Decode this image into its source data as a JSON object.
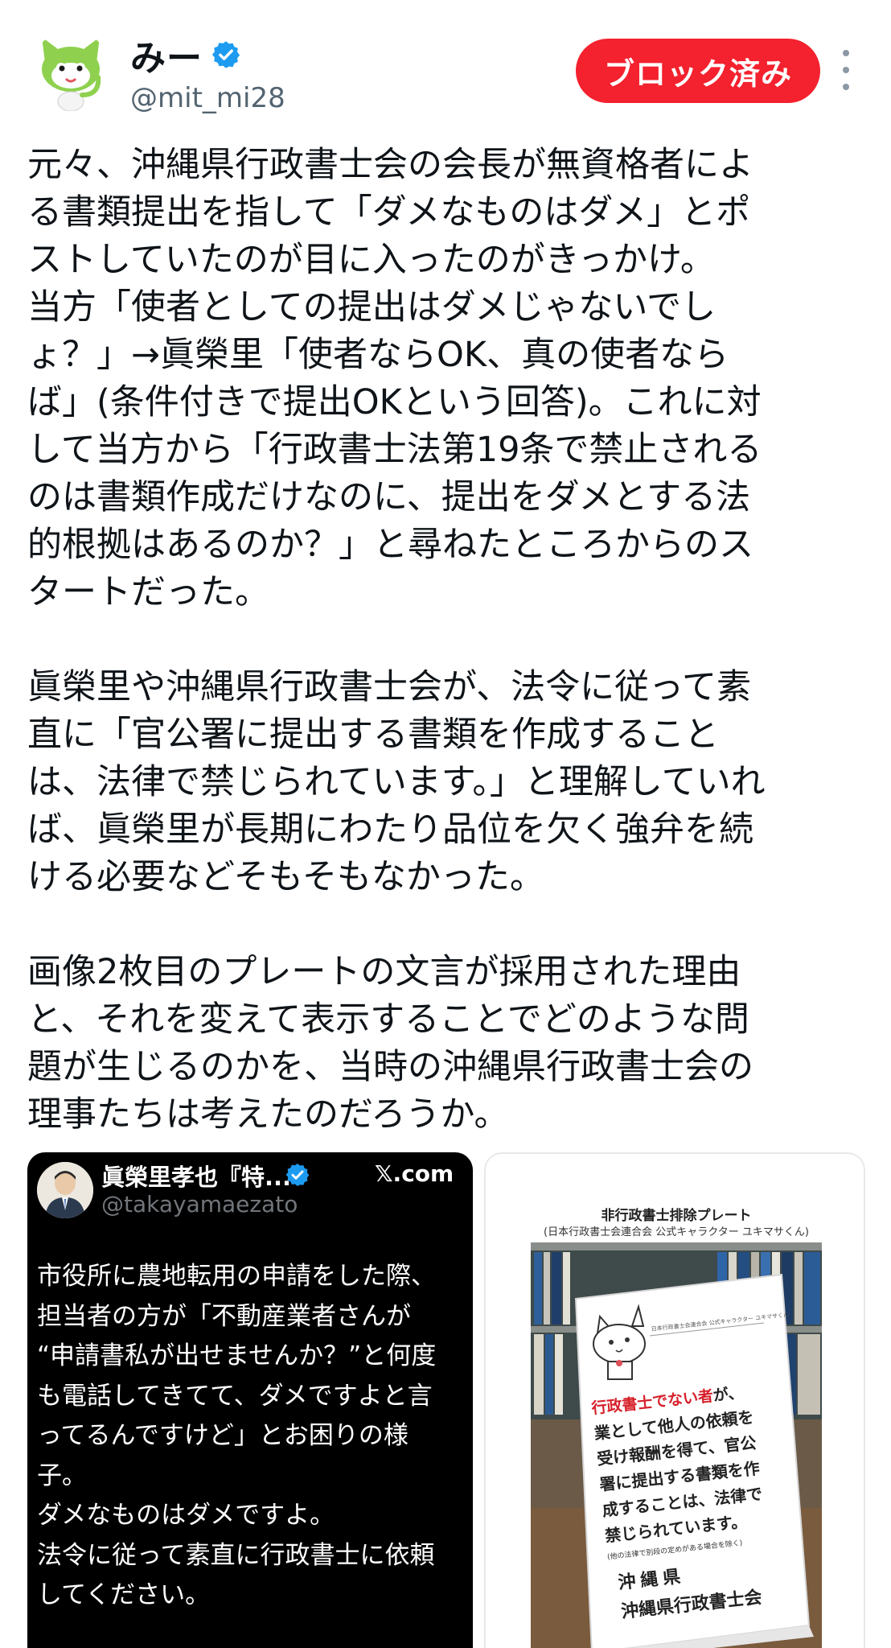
{
  "header": {
    "display_name": "みー",
    "handle": "@mit_mi28",
    "block_label": "ブロック済み",
    "avatar_icon": "green-cat-mascot-icon",
    "verified_icon": "verified-badge-icon",
    "more_icon": "more-vertical-icon"
  },
  "tweet": {
    "paragraphs": [
      [
        "元々、沖縄県行政書士会の会長が無資格者によ",
        "る書類提出を指して「ダメなものはダメ」とポ",
        "ストしていたのが目に入ったのがきっかけ。",
        "当方「使者としての提出はダメじゃないでし",
        "ょ？」→眞榮里「使者ならOK、真の使者なら",
        "ば」(条件付きで提出OKという回答)。これに対",
        "して当方から「行政書士法第19条で禁止される",
        "のは書類作成だけなのに、提出をダメとする法",
        "的根拠はあるのか？」と尋ねたところからのス",
        "タートだった。"
      ],
      [
        "眞榮里や沖縄県行政書士会が、法令に従って素",
        "直に「官公署に提出する書類を作成すること",
        "は、法律で禁じられています。」と理解していれ",
        "ば、眞榮里が長期にわたり品位を欠く強弁を続",
        "ける必要などそもそもなかった。"
      ],
      [
        "画像2枚目のプレートの文言が採用された理由",
        "と、それを変えて表示することでどのような問",
        "題が生じるのかを、当時の沖縄県行政書士会の",
        "理事たちは考えたのだろうか。"
      ]
    ]
  },
  "media_left": {
    "name": "眞榮里孝也『特...",
    "handle": "@takayamaezato",
    "site": "𝕏.com",
    "lines": [
      "市役所に農地転用の申請をした際、",
      "担当者の方が「不動産業者さんが",
      "“申請書私が出せませんか？”と何度",
      "も電話してきてて、ダメですよと言",
      "ってるんですけど」とお困りの様",
      "子。",
      "ダメなものはダメですよ。",
      "法令に従って素直に行政書士に依頼",
      "してください。"
    ]
  },
  "media_right": {
    "title": "非行政書士排除プレート",
    "subtitle": "(日本行政書士会連合会 公式キャラクター ユキマサくん)",
    "plate_lines": [
      "業として他人の依頼を",
      "受け報酬を得て、官公",
      "署に提出する書類を作",
      "成することは、法律で",
      "禁じられています。"
    ],
    "plate_highlight": "行政書士でない者",
    "plate_highlight_suffix": "が、",
    "plate_note": "(他の法律で別段の定めがある場合を除く)",
    "plate_pref": "沖縄県",
    "plate_assoc": "沖縄県行政書士会",
    "plate_small": "日本行政書士会連合会 公式キャラクター ユキマサくん"
  },
  "colors": {
    "block_red": "#f4212e",
    "verified_blue": "#1d9bf0",
    "handle_gray": "#536471"
  }
}
